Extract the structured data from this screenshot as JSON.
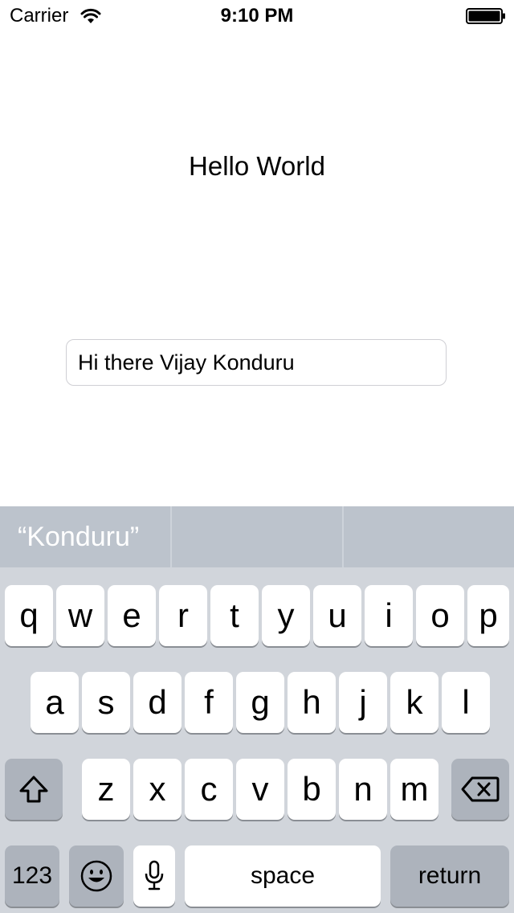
{
  "status_bar": {
    "carrier": "Carrier",
    "time": "9:10 PM",
    "wifi_icon": "wifi-icon",
    "battery_icon": "battery-icon"
  },
  "main": {
    "label": "Hello World",
    "text_field_value": "Hi there Vijay Konduru"
  },
  "keyboard": {
    "predictions": [
      "“Konduru”",
      "",
      ""
    ],
    "row1": [
      "q",
      "w",
      "e",
      "r",
      "t",
      "y",
      "u",
      "i",
      "o",
      "p"
    ],
    "row2": [
      "a",
      "s",
      "d",
      "f",
      "g",
      "h",
      "j",
      "k",
      "l"
    ],
    "row3": [
      "z",
      "x",
      "c",
      "v",
      "b",
      "n",
      "m"
    ],
    "numbers_label": "123",
    "space_label": "space",
    "return_label": "return",
    "icons": {
      "shift": "shift-icon",
      "delete": "backspace-icon",
      "emoji": "emoji-icon",
      "dictation": "microphone-icon"
    },
    "colors": {
      "background": "#d1d5db",
      "predictive_bar": "#bcc3cc",
      "key": "#ffffff",
      "special_key": "#adb3bc"
    }
  }
}
